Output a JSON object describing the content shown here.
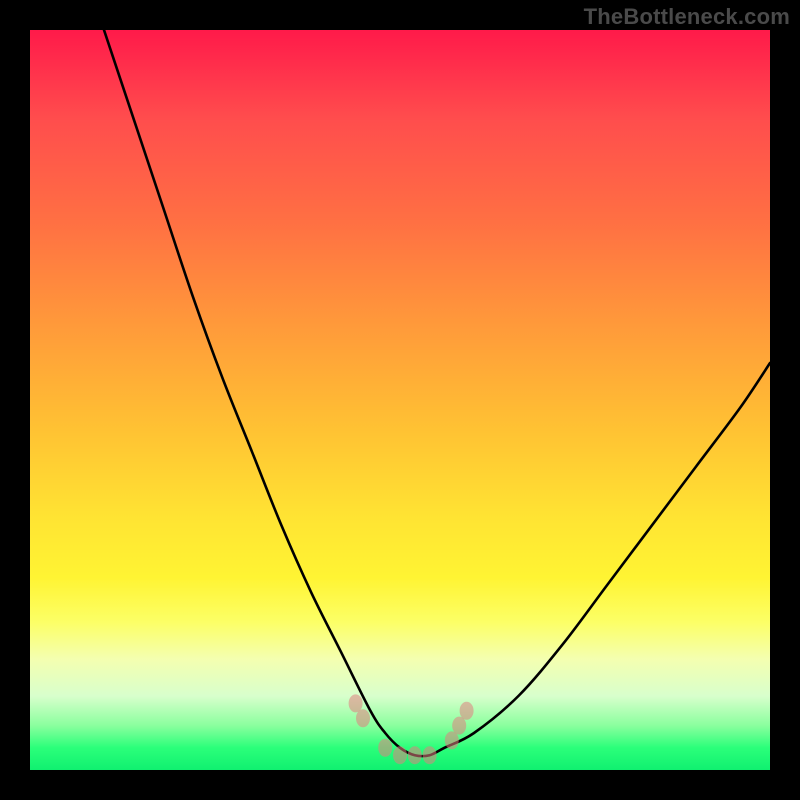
{
  "watermark": "TheBottleneck.com",
  "chart_data": {
    "type": "line",
    "title": "",
    "xlabel": "",
    "ylabel": "",
    "xlim": [
      0,
      100
    ],
    "ylim": [
      0,
      100
    ],
    "grid": false,
    "legend": null,
    "series": [
      {
        "name": "bottleneck-curve",
        "x": [
          10,
          14,
          18,
          22,
          26,
          30,
          34,
          38,
          42,
          46,
          48,
          50,
          52,
          54,
          56,
          60,
          66,
          72,
          78,
          84,
          90,
          96,
          100
        ],
        "y": [
          100,
          88,
          76,
          64,
          53,
          43,
          33,
          24,
          16,
          8,
          5,
          3,
          2,
          2,
          3,
          5,
          10,
          17,
          25,
          33,
          41,
          49,
          55
        ]
      }
    ],
    "markers": {
      "name": "valley-dots",
      "x": [
        44,
        45,
        48,
        50,
        52,
        54,
        57,
        58,
        59
      ],
      "y": [
        9,
        7,
        3,
        2,
        2,
        2,
        4,
        6,
        8
      ]
    },
    "background_gradient": {
      "top": "#ff1a4a",
      "mid": "#ffe433",
      "bottom": "#10f070"
    }
  }
}
